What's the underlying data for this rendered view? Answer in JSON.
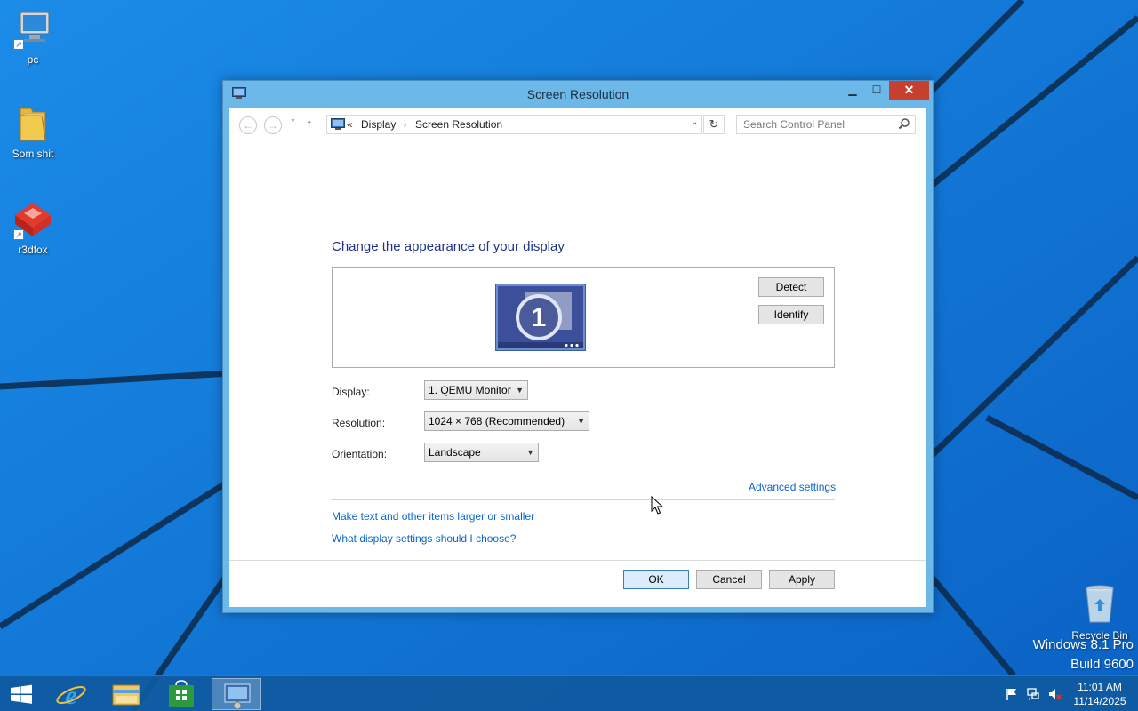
{
  "desktop": {
    "icons": [
      {
        "label": "pc",
        "icon": "computer-icon"
      },
      {
        "label": "Som shit",
        "icon": "folder-icon"
      },
      {
        "label": "r3dfox",
        "icon": "r3dfox-icon"
      },
      {
        "label": "Recycle Bin",
        "icon": "recycle-bin-icon"
      }
    ],
    "watermark": {
      "line1": "Windows 8.1 Pro",
      "line2": "Build 9600"
    }
  },
  "window": {
    "title": "Screen Resolution",
    "controls": {
      "minimize": "▁",
      "maximize": "☐",
      "close": "✕"
    }
  },
  "address_bar": {
    "prefix": "«",
    "breadcrumbs": [
      "Display",
      "Screen Resolution"
    ],
    "separator": "›"
  },
  "search": {
    "placeholder": "Search Control Panel"
  },
  "content": {
    "heading": "Change the appearance of your display",
    "monitor_number": "1",
    "detect_button": "Detect",
    "identify_button": "Identify",
    "display": {
      "label": "Display:",
      "value": "1. QEMU Monitor"
    },
    "resolution": {
      "label": "Resolution:",
      "value": "1024 × 768 (Recommended)"
    },
    "orientation": {
      "label": "Orientation:",
      "value": "Landscape"
    },
    "advanced_link": "Advanced settings",
    "links": [
      "Make text and other items larger or smaller",
      "What display settings should I choose?"
    ],
    "ok_button": "OK",
    "cancel_button": "Cancel",
    "apply_button": "Apply"
  },
  "taskbar": {
    "items": [
      "start-icon",
      "internet-explorer-icon",
      "file-explorer-icon",
      "store-icon",
      "display-settings-icon"
    ],
    "clock": {
      "time": "11:01 AM",
      "date": "11/14/2025"
    }
  },
  "colors": {
    "accent": "#0a74d6",
    "link": "#0a66cc",
    "heading": "#1e3287",
    "close": "#c7402f"
  }
}
